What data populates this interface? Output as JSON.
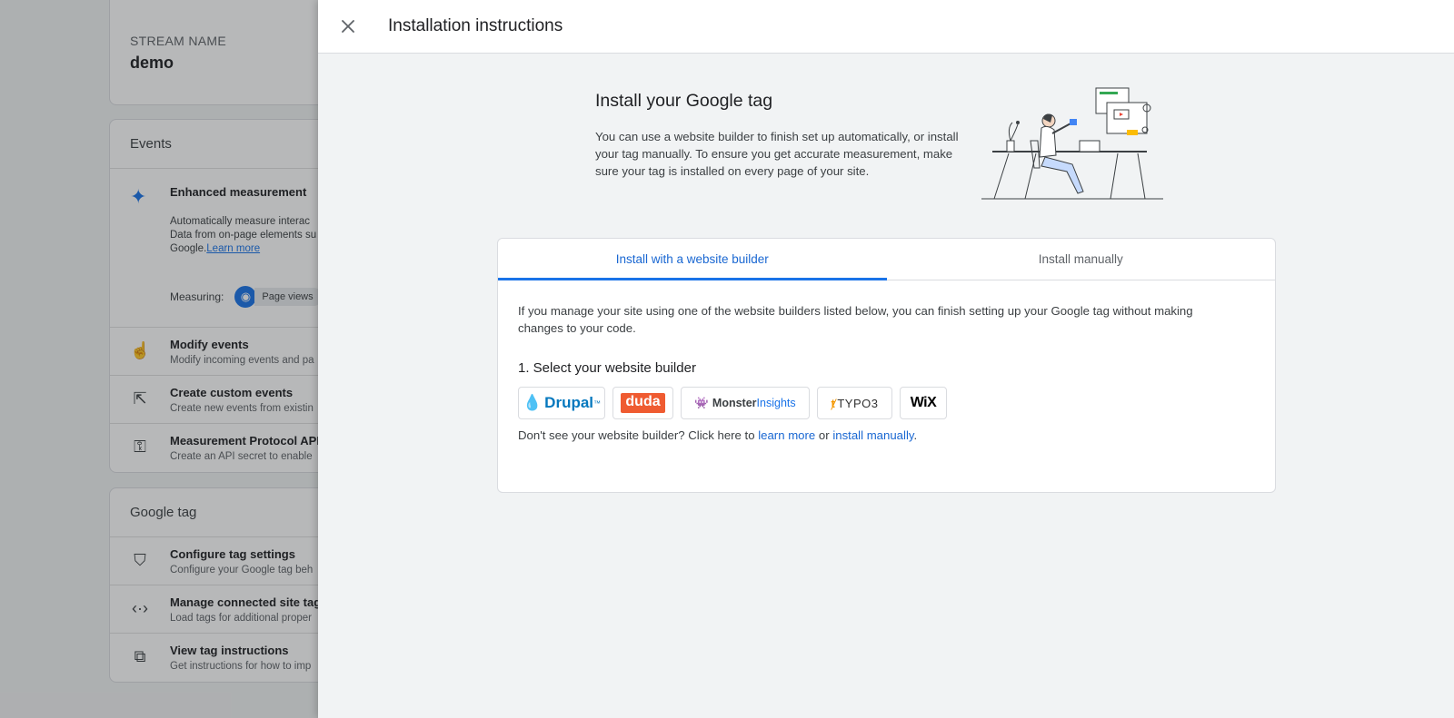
{
  "background": {
    "stream": {
      "label": "STREAM NAME",
      "value": "demo"
    },
    "events": {
      "title": "Events",
      "enhanced": {
        "title": "Enhanced measurement",
        "line1": "Automatically measure interac",
        "line2": "Data from on-page elements su",
        "line3": "Google.",
        "learn_more": "Learn more",
        "measuring_label": "Measuring:",
        "chip": "Page views"
      },
      "rows": [
        {
          "title": "Modify events",
          "sub": "Modify incoming events and pa"
        },
        {
          "title": "Create custom events",
          "sub": "Create new events from existin"
        },
        {
          "title": "Measurement Protocol API",
          "sub": "Create an API secret to enable"
        }
      ]
    },
    "google_tag": {
      "title": "Google tag",
      "rows": [
        {
          "title": "Configure tag settings",
          "sub": "Configure your Google tag beh"
        },
        {
          "title": "Manage connected site tag",
          "sub": "Load tags for additional proper"
        },
        {
          "title": "View tag instructions",
          "sub": "Get instructions for how to imp"
        }
      ]
    }
  },
  "drawer": {
    "title": "Installation instructions",
    "intro": {
      "heading": "Install your Google tag",
      "body": "You can use a website builder to finish set up automatically, or install your tag manually. To ensure you get accurate measurement, make sure your tag is installed on every page of your site."
    },
    "tabs": [
      {
        "label": "Install with a website builder",
        "active": true
      },
      {
        "label": "Install manually",
        "active": false
      }
    ],
    "panel": {
      "desc": "If you manage your site using one of the website builders listed below, you can finish setting up your Google tag without making changes to your code.",
      "step": "1. Select your website builder",
      "builders": {
        "drupal": "Drupal",
        "drupal_tm": "™",
        "duda": "duda",
        "monster_a": "Monster",
        "monster_b": "Insights",
        "typo3": "TYPO3",
        "wix": "WiX"
      },
      "hint_prefix": "Don't see your website builder? Click here to ",
      "hint_link1": "learn more",
      "hint_mid": " or ",
      "hint_link2": "install manually",
      "hint_suffix": "."
    }
  },
  "colors": {
    "accent": "#1a73e8",
    "duda": "#ef5b31",
    "typo3": "#f49700",
    "drupal": "#0678be"
  }
}
